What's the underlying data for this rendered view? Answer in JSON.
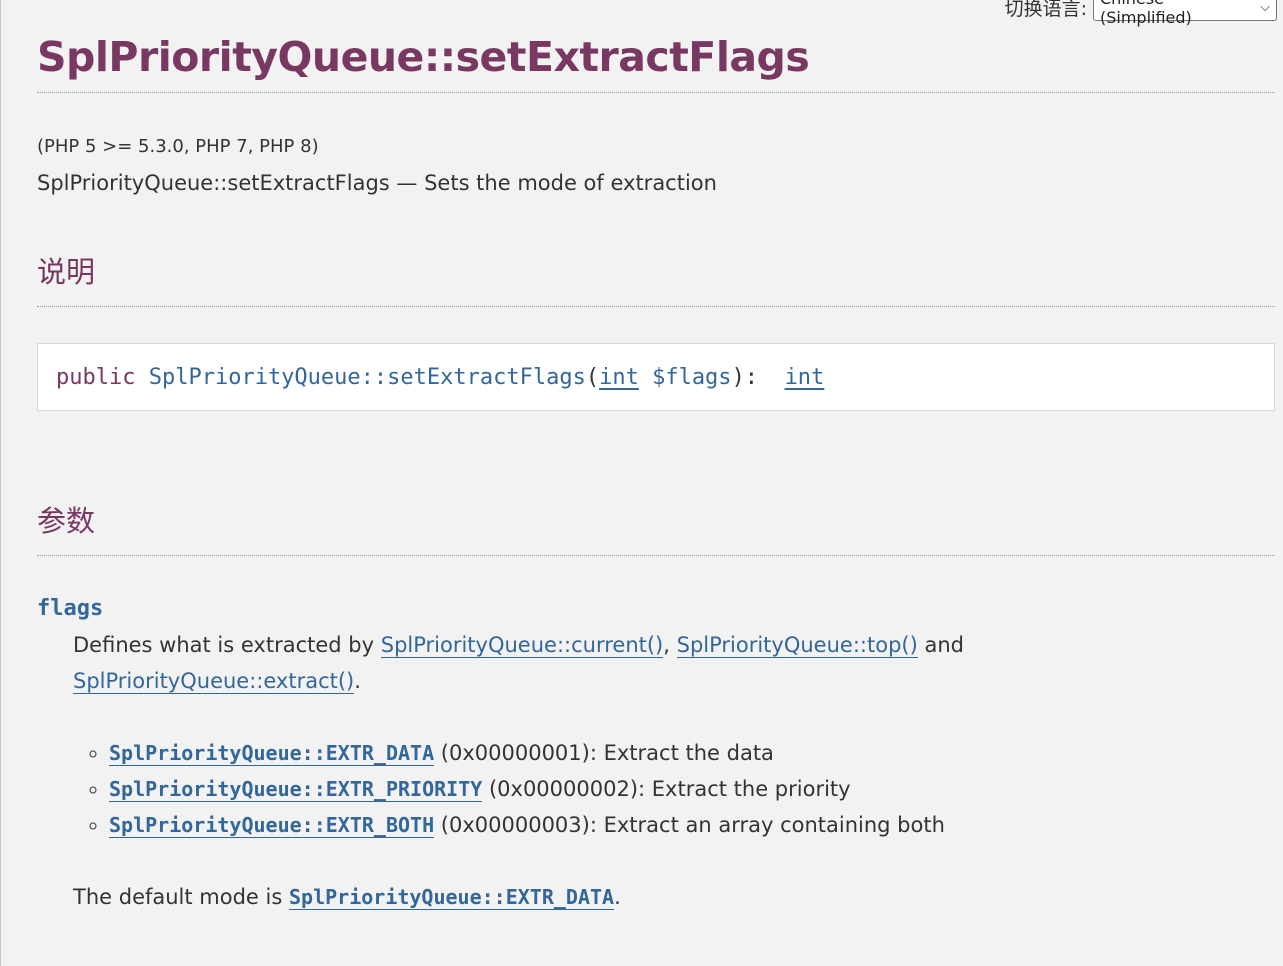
{
  "lang_switch": {
    "label": "切换语言:",
    "selected": "Chinese (Simplified)"
  },
  "title": "SplPriorityQueue::setExtractFlags",
  "versions": "(PHP 5 >= 5.3.0, PHP 7, PHP 8)",
  "refpurpose": "SplPriorityQueue::setExtractFlags — Sets the mode of extraction",
  "sections": {
    "description": "说明",
    "parameters": "参数"
  },
  "synopsis": {
    "modifier": "public",
    "method": "SplPriorityQueue::setExtractFlags",
    "open_paren": "(",
    "param_type": "int",
    "param_var": "$flags",
    "close": "): ",
    "return_type": "int"
  },
  "param": {
    "name": "flags",
    "desc_prefix": "Defines what is extracted by ",
    "link_current": "SplPriorityQueue::current()",
    "comma": ", ",
    "link_top": "SplPriorityQueue::top()",
    "and": " and ",
    "link_extract": "SplPriorityQueue::extract()",
    "period": ".",
    "flags": [
      {
        "const": "SplPriorityQueue::EXTR_DATA",
        "text": " (0x00000001): Extract the data"
      },
      {
        "const": "SplPriorityQueue::EXTR_PRIORITY",
        "text": " (0x00000002): Extract the priority"
      },
      {
        "const": "SplPriorityQueue::EXTR_BOTH",
        "text": " (0x00000003): Extract an array containing both"
      }
    ],
    "default_prefix": "The default mode is ",
    "default_const": "SplPriorityQueue::EXTR_DATA",
    "default_suffix": "."
  }
}
